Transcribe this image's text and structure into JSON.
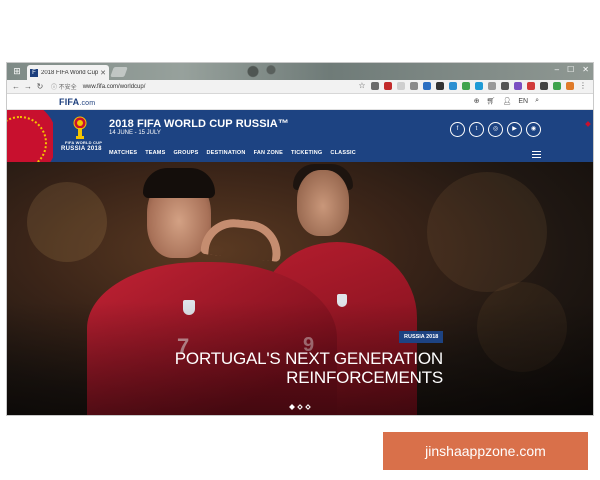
{
  "browser": {
    "tab_title": "2018 FIFA World Cup R",
    "tab_favicon": "F",
    "address_info": "不安全",
    "url": "www.fifa.com/worldcup/"
  },
  "fifa_bar": {
    "logo": "FIFA",
    "logo_suffix": ".com",
    "lang": "EN"
  },
  "header": {
    "emblem_line1": "FIFA WORLD CUP",
    "emblem_line2": "RUSSIA 2018",
    "title": "2018 FIFA WORLD CUP RUSSIA™",
    "dates": "14 JUNE - 15 JULY",
    "nav": [
      "MATCHES",
      "TEAMS",
      "GROUPS",
      "DESTINATION",
      "FAN ZONE",
      "TICKETING",
      "CLASSIC"
    ]
  },
  "hero": {
    "tag": "RUSSIA 2018",
    "headline_line1": "PORTUGAL'S NEXT GENERATION",
    "headline_line2": "REINFORCEMENTS",
    "jersey_number_front": "7",
    "jersey_number_back": "9"
  },
  "watermark": "jinshaappzone.com",
  "colors": {
    "header_blue": "#1d4382",
    "accent_red": "#c8102e",
    "watermark_orange": "#d9704a"
  }
}
